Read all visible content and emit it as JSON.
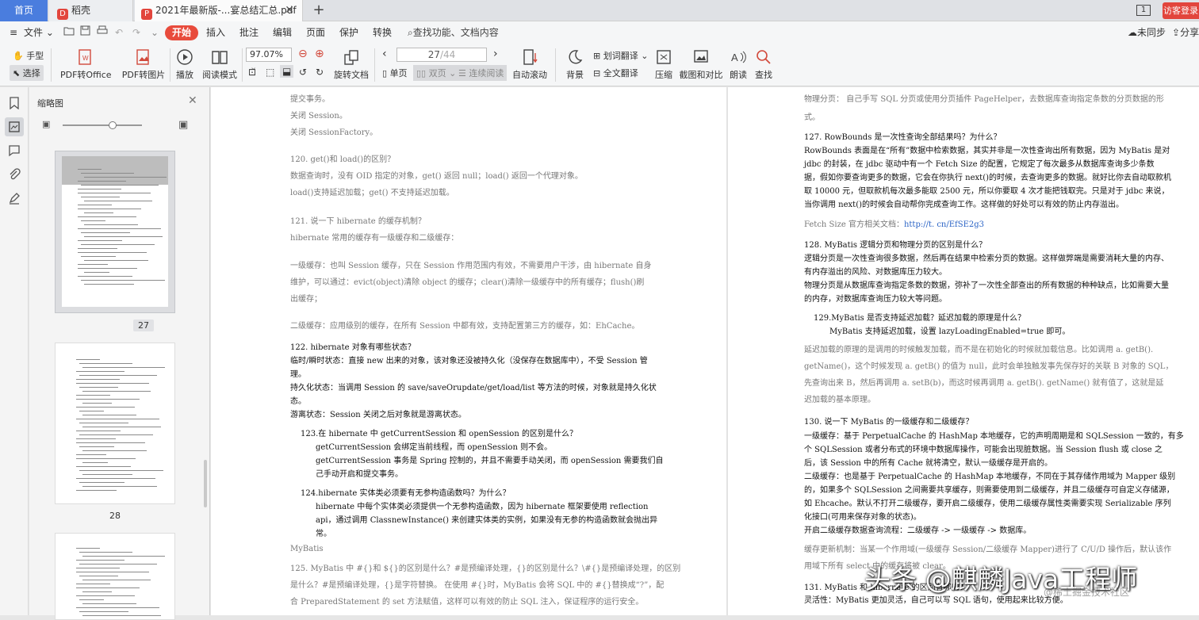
{
  "tabs": {
    "home": "首页",
    "daoke": "稻壳",
    "pdf": "2021年最新版-...宴总结汇总.pdf",
    "visitor": "访客登录",
    "window_num": "1"
  },
  "menu": {
    "file": "文件",
    "start": "开始",
    "insert": "插入",
    "annotate": "批注",
    "edit": "编辑",
    "page": "页面",
    "protect": "保护",
    "convert": "转换",
    "search_placeholder": "查找功能、文档内容",
    "sync": "未同步",
    "share": "分享"
  },
  "ribbon": {
    "hand": "手型",
    "select": "选择",
    "pdf_to_office": "PDF转Office",
    "pdf_to_image": "PDF转图片",
    "play": "播放",
    "read_mode": "阅读模式",
    "zoom": "97.07%",
    "rotate": "旋转文档",
    "page_current": "27",
    "page_total": "/44",
    "single": "单页",
    "double": "双页",
    "continuous": "连续阅读",
    "auto_scroll": "自动滚动",
    "background": "背景",
    "word_translate": "划词翻译",
    "full_translate": "全文翻译",
    "compress": "压缩",
    "screenshot_compare": "截图和对比",
    "read_aloud": "朗读",
    "find": "查找"
  },
  "thumbnails": {
    "title": "缩略图",
    "pages": [
      "27",
      "28"
    ]
  },
  "left_page": [
    {
      "t": "提交事务。"
    },
    {
      "t": "关闭 Session。"
    },
    {
      "t": "关闭 SessionFactory。"
    },
    {
      "t": "120. get()和 load()的区别？"
    },
    {
      "t": "数据查询时，没有 OID 指定的对象，get() 返回 null；load() 返回一个代理对象。"
    },
    {
      "t": "load()支持延迟加载；get() 不支持延迟加载。"
    },
    {
      "t": "121. 说一下 hibernate 的缓存机制？"
    },
    {
      "t": "hibernate 常用的缓存有一级缓存和二级缓存："
    },
    {
      "t": "一级缓存：也叫 Session 缓存，只在 Session 作用范围内有效，不需要用户干涉，由 hibernate 自身"
    },
    {
      "t": "维护，可以通过：evict(object)清除 object 的缓存；clear()清除一级缓存中的所有缓存；flush()刷"
    },
    {
      "t": "出缓存；"
    },
    {
      "t": "二级缓存：应用级别的缓存，在所有 Session 中都有效，支持配置第三方的缓存，如：EhCache。"
    },
    {
      "t": "122. hibernate 对象有哪些状态？"
    },
    {
      "t": "临时/瞬时状态：直接 new 出来的对象，该对象还没被持久化（没保存在数据库中），不受 Session 管"
    },
    {
      "t": "理。"
    },
    {
      "t": "持久化状态：当调用 Session 的 save/saveOrupdate/get/load/list 等方法的时候，对象就是持久化状"
    },
    {
      "t": "态。"
    },
    {
      "t": "游离状态：Session 关闭之后对象就是游离状态。"
    },
    {
      "t": "123.在 hibernate 中 getCurrentSession 和 openSession 的区别是什么？"
    },
    {
      "t": "getCurrentSession 会绑定当前线程，而 openSession 则不会。"
    },
    {
      "t": "getCurrentSession 事务是 Spring 控制的，并且不需要手动关闭，而 openSession 需要我们自"
    },
    {
      "t": "己手动开启和提交事务。"
    },
    {
      "t": "124.hibernate 实体类必须要有无参构造函数吗？为什么？"
    },
    {
      "t": "hibernate 中每个实体类必须提供一个无参构造函数，因为 hibernate 框架要使用 reflection"
    },
    {
      "t": "api，通过调用 ClassnewInstance() 来创建实体类的实例，如果没有无参的构造函数就会抛出异"
    },
    {
      "t": "常。"
    },
    {
      "t": "MyBatis"
    },
    {
      "t": "125. MyBatis 中 #{}和 ${}的区别是什么？#是预编译处理，{}的区别是什么？\\#{}是预编译处理，的区别"
    },
    {
      "t": "是什么？#是预编译处理，{}是字符替换。 在使用 #{}时，MyBatis 会将 SQL 中的 #{}替换成“?”，配"
    },
    {
      "t": "合 PreparedStatement 的 set 方法赋值，这样可以有效的防止 SQL 注入，保证程序的运行安全。"
    }
  ],
  "right_page": [
    {
      "t": "物理分页： 自己手写 SQL 分页或使用分页插件 PageHelper，去数据库查询指定条数的分页数据的形"
    },
    {
      "t": "式。"
    },
    {
      "t": "127. RowBounds 是一次性查询全部结果吗？为什么？"
    },
    {
      "t": "RowBounds 表面是在“所有”数据中检索数据，其实并非是一次性查询出所有数据，因为 MyBatis 是对"
    },
    {
      "t": "jdbc 的封装，在 jdbc 驱动中有一个 Fetch Size 的配置，它规定了每次最多从数据库查询多少条数"
    },
    {
      "t": "据，假如你要查询更多的数据，它会在你执行 next()的时候，去查询更多的数据。就好比你去自动取款机"
    },
    {
      "t": "取 10000 元，但取款机每次最多能取 2500 元，所以你要取 4 次才能把钱取完。只是对于 jdbc 来说，"
    },
    {
      "t": "当你调用 next()的时候会自动帮你完成查询工作。这样做的好处可以有效的防止内存溢出。"
    },
    {
      "t": "Fetch Size 官方相关文档：",
      "link": "http://t. cn/EfSE2g3"
    },
    {
      "t": "128. MyBatis 逻辑分页和物理分页的区别是什么？"
    },
    {
      "t": "逻辑分页是一次性查询很多数据，然后再在结果中检索分页的数据。这样做弊端是需要消耗大量的内存、"
    },
    {
      "t": "有内存溢出的风险、对数据库压力较大。"
    },
    {
      "t": "物理分页是从数据库查询指定条数的数据，弥补了一次性全部查出的所有数据的种种缺点，比如需要大量"
    },
    {
      "t": "的内存，对数据库查询压力较大等问题。"
    },
    {
      "t": "129.MyBatis 是否支持延迟加载？延迟加载的原理是什么？"
    },
    {
      "t": "MyBatis 支持延迟加载，设置 lazyLoadingEnabled=true 即可。"
    },
    {
      "t": "延迟加载的原理的是调用的时候触发加载，而不是在初始化的时候就加载信息。比如调用 a. getB()."
    },
    {
      "t": "getName()，这个时候发现 a. getB() 的值为 null，此时会单独触发事先保存好的关联 B 对象的 SQL，"
    },
    {
      "t": "先查询出来 B，然后再调用 a. setB(b)，而这时候再调用 a. getB(). getName() 就有值了，这就是延"
    },
    {
      "t": "迟加载的基本原理。"
    },
    {
      "t": "130. 说一下 MyBatis 的一级缓存和二级缓存？"
    },
    {
      "t": "一级缓存：基于 PerpetualCache 的 HashMap 本地缓存，它的声明周期是和 SQLSession 一致的，有多"
    },
    {
      "t": "个 SQLSession 或者分布式的环境中数据库操作，可能会出现脏数据。当 Session flush 或 close 之"
    },
    {
      "t": "后，该 Session 中的所有 Cache 就将清空，默认一级缓存是开启的。"
    },
    {
      "t": "二级缓存：也是基于 PerpetualCache 的 HashMap 本地缓存，不同在于其存储作用域为 Mapper 级别"
    },
    {
      "t": "的，如果多个 SQLSession 之间需要共享缓存，则需要使用到二级缓存，并且二级缓存可自定义存储源，"
    },
    {
      "t": "如 Ehcache。默认不打开二级缓存，要开启二级缓存，使用二级缓存属性类需要实现 Serializable 序列"
    },
    {
      "t": "化接口(可用来保存对象的状态)。"
    },
    {
      "t": "开启二级缓存数据查询流程：二级缓存 -> 一级缓存 -> 数据库。"
    },
    {
      "t": "缓存更新机制：当某一个作用域(一级缓存 Session/二级缓存 Mapper)进行了 C/U/D 操作后，默认该作"
    },
    {
      "t": "用域下所有 select 中的缓存将被 clear。"
    },
    {
      "t": "131. MyBatis 和 hibernate 的区别有哪些？"
    },
    {
      "t": "灵活性：MyBatis 更加灵活，自己可以写 SQL 语句，使用起来比较方便。"
    }
  ],
  "watermark": "头条 @麒麟Java工程师",
  "watermark_small": "@稀土掘金技术社区"
}
